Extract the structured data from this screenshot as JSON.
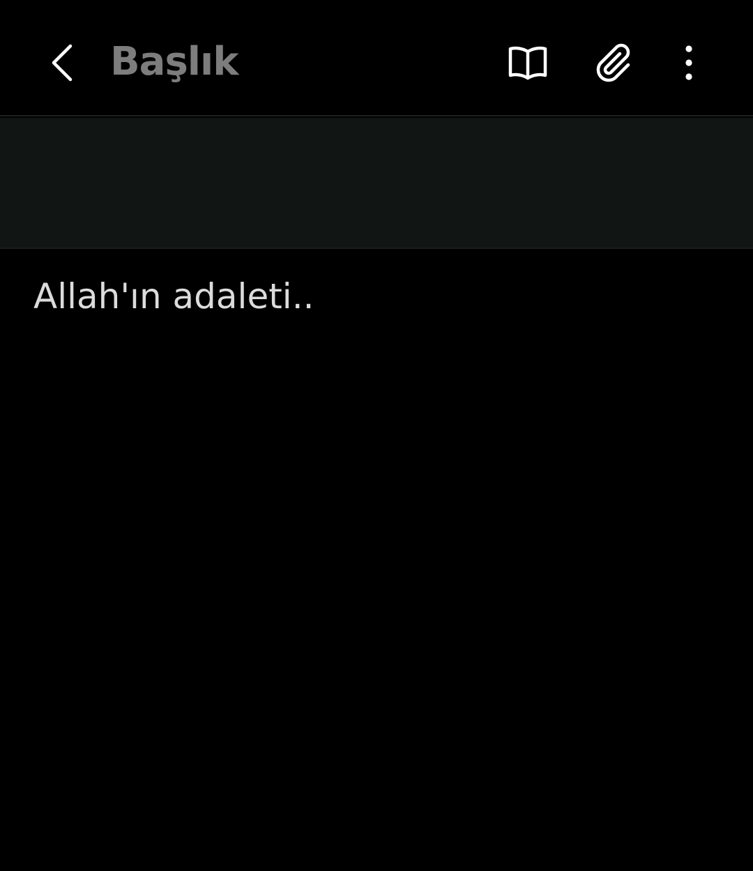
{
  "toolbar": {
    "back_icon": "chevron-left-icon",
    "title": "Başlık",
    "actions": [
      {
        "name": "reading-mode-button",
        "icon": "open-book-icon"
      },
      {
        "name": "attach-button",
        "icon": "paperclip-icon"
      },
      {
        "name": "more-options-button",
        "icon": "vertical-dots-icon"
      }
    ]
  },
  "note": {
    "body": "Allah'ın adaleti.."
  },
  "colors": {
    "background": "#000000",
    "format_band": "#111614",
    "title_text": "#7d7d7d",
    "body_text": "#dcdcdc",
    "icon": "#ffffff"
  }
}
